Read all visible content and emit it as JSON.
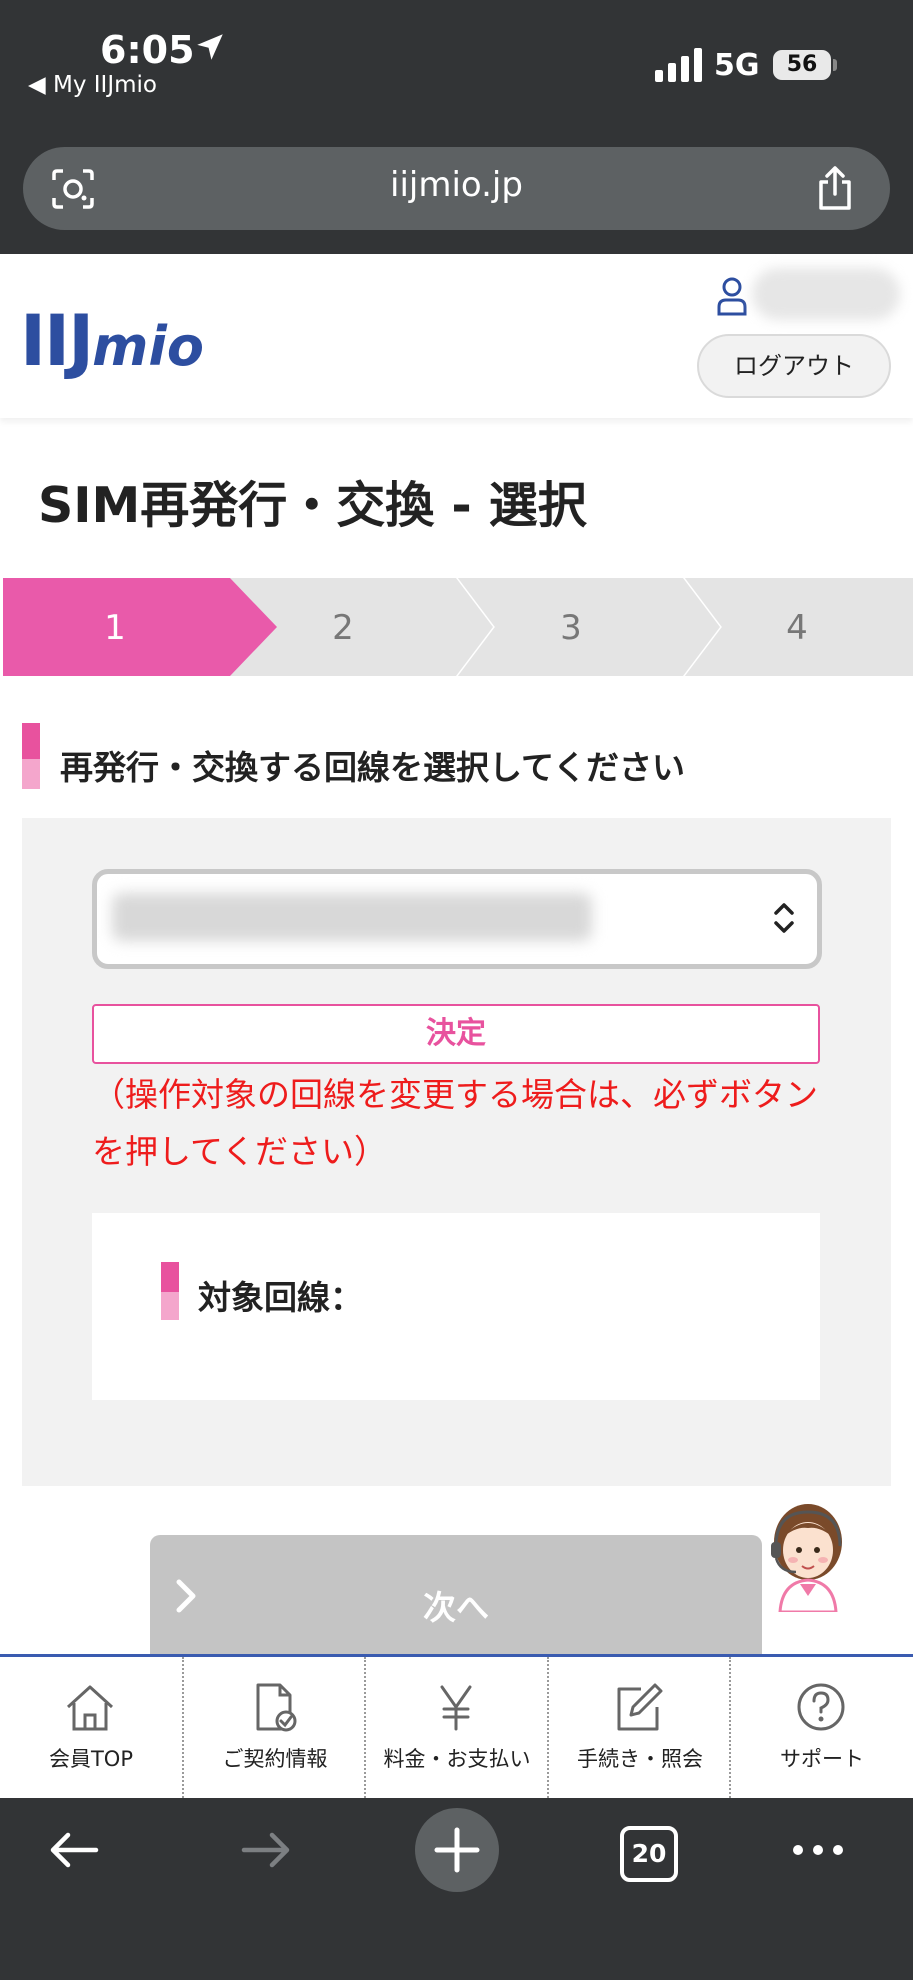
{
  "status_bar": {
    "time": "6:05",
    "back_app": "◀ My IIJmio",
    "network": "5G",
    "battery": "56"
  },
  "browser": {
    "url": "iijmio.jp",
    "tab_count": "20"
  },
  "header": {
    "logo_iij": "IIJ",
    "logo_mio": "mio",
    "logout_label": "ログアウト"
  },
  "page": {
    "title": "SIM再発行・交換 - 選択"
  },
  "stepper": {
    "steps": [
      "1",
      "2",
      "3",
      "4"
    ],
    "active_step": 1,
    "colors": {
      "active": "#e95aaa",
      "inactive": "#e4e4e4"
    }
  },
  "section": {
    "heading": "再発行・交換する回線を選択してください",
    "decide_label": "決定",
    "notice": "（操作対象の回線を変更する場合は、必ずボタンを押してください）",
    "target_label": "対象回線："
  },
  "next_label": "次へ",
  "nav": {
    "items": [
      {
        "label": "会員TOP",
        "icon": "home-icon"
      },
      {
        "label": "ご契約情報",
        "icon": "contract-info-icon"
      },
      {
        "label": "料金・お支払い",
        "icon": "yen-icon"
      },
      {
        "label": "手続き・照会",
        "icon": "edit-icon"
      },
      {
        "label": "サポート",
        "icon": "help-icon"
      }
    ]
  },
  "colors": {
    "accent_pink": "#e8529e",
    "brand_blue": "#2d4ea0",
    "notice_red": "#ee1c1c",
    "chrome_dark": "#323436"
  }
}
